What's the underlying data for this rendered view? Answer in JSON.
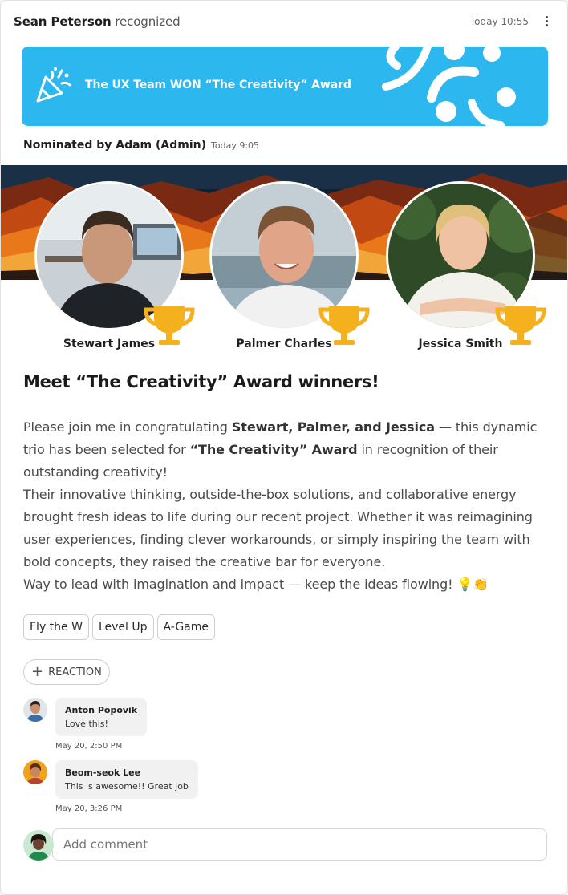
{
  "header": {
    "author": "Sean Peterson",
    "action": "recognized",
    "time": "Today 10:55"
  },
  "banner": {
    "title": "The UX Team WON “The Creativity” Award",
    "color": "#2cb7ef"
  },
  "nomination": {
    "text": "Nominated by Adam (Admin)",
    "time": "Today 9:05"
  },
  "winners": [
    {
      "name": "Stewart James"
    },
    {
      "name": "Palmer Charles"
    },
    {
      "name": "Jessica Smith"
    }
  ],
  "heading": "Meet “The Creativity” Award winners!",
  "body": {
    "p1_start": "Please join me in congratulating ",
    "p1_bold1": "Stewart, Palmer, and Jessica",
    "p1_mid": " — this dynamic trio has been selected for ",
    "p1_bold2": "“The Creativity” Award",
    "p1_end": " in recognition of their outstanding creativity!",
    "p2": "Their innovative thinking, outside-the-box solutions, and collaborative energy brought fresh ideas to life during our recent project. Whether it was reimagining user experiences, finding clever workarounds, or simply inspiring the team with bold concepts, they raised the creative bar for everyone.",
    "p3": "Way to lead with imagination and impact — keep the ideas flowing! 💡👏"
  },
  "tags": [
    "Fly the W",
    "Level Up",
    "A-Game"
  ],
  "reaction_label": "REACTION",
  "comments": [
    {
      "author": "Anton Popovik",
      "text": "Love this!",
      "date": "May 20, 2:50 PM"
    },
    {
      "author": "Beom-seok Lee",
      "text": "This is awesome!! Great job",
      "date": "May 20, 3:26 PM"
    }
  ],
  "add_comment_placeholder": "Add comment",
  "colors": {
    "trophy": "#f5b01e",
    "accent": "#2cb7ef"
  }
}
